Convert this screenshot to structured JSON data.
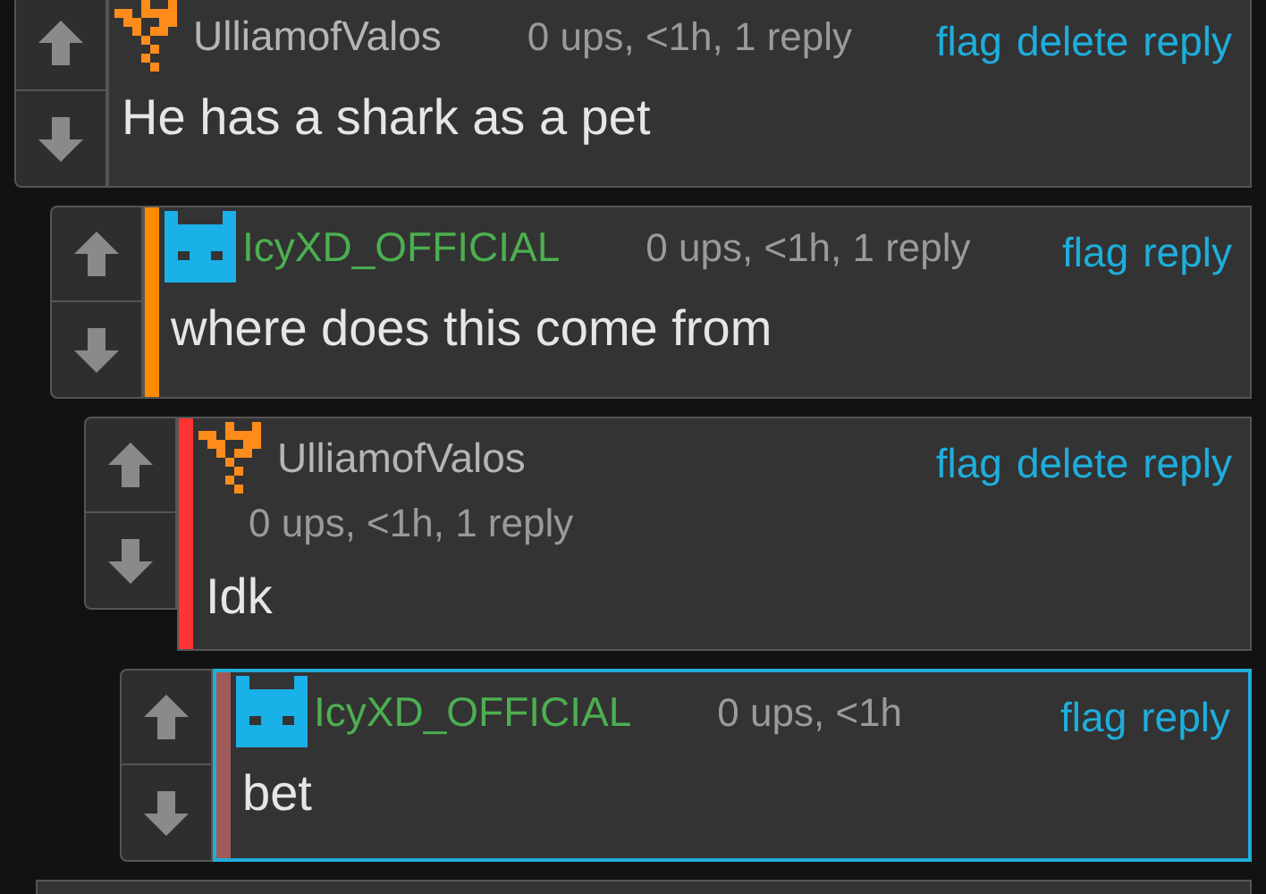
{
  "comments": [
    {
      "kind": "orange",
      "username": "UlliamofValos",
      "meta": "0 ups, <1h, 1 reply",
      "actions": [
        "flag",
        "delete",
        "reply"
      ],
      "body": "He has a shark as a pet",
      "highlighted": false,
      "children": [
        {
          "kind": "blue",
          "username": "IcyXD_OFFICIAL",
          "color": "#ff8c00",
          "meta": "0 ups, <1h, 1 reply",
          "actions": [
            "flag",
            "reply"
          ],
          "body": "where does this come from",
          "highlighted": false,
          "children": [
            {
              "kind": "orange",
              "username": "UlliamofValos",
              "color": "#ff3333",
              "meta": "0 ups, <1h, 1 reply",
              "actions": [
                "flag",
                "delete",
                "reply"
              ],
              "body": "Idk",
              "highlighted": false,
              "children": [
                {
                  "kind": "blue",
                  "username": "IcyXD_OFFICIAL",
                  "color": "#a05a5a",
                  "meta": "0 ups, <1h",
                  "actions": [
                    "flag",
                    "reply"
                  ],
                  "body": "bet",
                  "highlighted": true
                }
              ]
            }
          ]
        }
      ]
    }
  ]
}
